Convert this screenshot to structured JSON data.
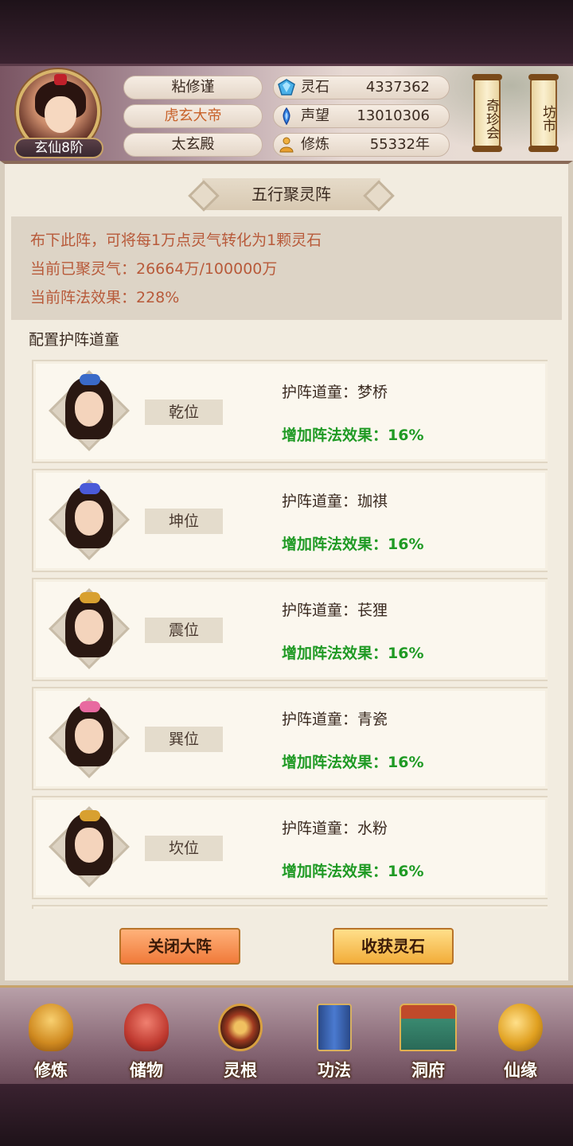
{
  "header": {
    "player_name": "粘修谨",
    "title": "虎玄大帝",
    "palace": "太玄殿",
    "rank_badge": "玄仙8阶",
    "resources": [
      {
        "icon": "spirit-stone-icon",
        "label": "灵石",
        "value": "4337362"
      },
      {
        "icon": "prestige-icon",
        "label": "声望",
        "value": "13010306"
      },
      {
        "icon": "cultivation-icon",
        "label": "修炼",
        "value": "55332年"
      }
    ],
    "side_buttons": [
      {
        "label": "奇珍会"
      },
      {
        "label": "坊市"
      }
    ]
  },
  "panel": {
    "title": "五行聚灵阵",
    "info_lines": [
      "布下此阵，可将每1万点灵气转化为1颗灵石",
      "当前已聚灵气：26664万/100000万",
      "当前阵法效果：228%"
    ],
    "section_label": "配置护阵道童",
    "guards": [
      {
        "position": "乾位",
        "name": "护阵道童：梦桥",
        "bonus": "增加阵法效果：16%"
      },
      {
        "position": "坤位",
        "name": "护阵道童：珈祺",
        "bonus": "增加阵法效果：16%"
      },
      {
        "position": "震位",
        "name": "护阵道童：苌狸",
        "bonus": "增加阵法效果：16%"
      },
      {
        "position": "巽位",
        "name": "护阵道童：青瓷",
        "bonus": "增加阵法效果：16%"
      },
      {
        "position": "坎位",
        "name": "护阵道童：水粉",
        "bonus": "增加阵法效果：16%"
      }
    ],
    "buttons": {
      "close": "关闭大阵",
      "harvest": "收获灵石"
    }
  },
  "nav": [
    {
      "label": "修炼",
      "icon": "cultivate-monk-icon"
    },
    {
      "label": "储物",
      "icon": "storage-bag-icon"
    },
    {
      "label": "灵根",
      "icon": "spirit-root-icon"
    },
    {
      "label": "功法",
      "icon": "technique-book-icon"
    },
    {
      "label": "洞府",
      "icon": "cave-dwelling-icon"
    },
    {
      "label": "仙缘",
      "icon": "immortal-fate-icon"
    }
  ],
  "colors": {
    "info_text": "#b85a3a",
    "bonus_text": "#1f9a24",
    "title_text": "#c8622a",
    "accent_gold": "#c9a467"
  }
}
